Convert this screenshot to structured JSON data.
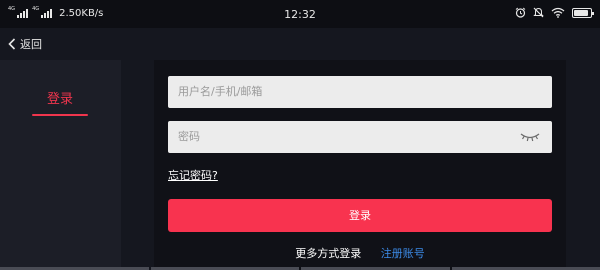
{
  "status_bar": {
    "signal1_label": "4G",
    "signal2_label": "4G",
    "net_speed": "2.50KB/s",
    "time": "12:32",
    "battery_level": 0.85
  },
  "title_bar": {
    "back_label": "返回"
  },
  "tabs": {
    "login_label": "登录"
  },
  "form": {
    "username_placeholder": "用户名/手机/邮箱",
    "password_placeholder": "密码",
    "forgot_password": "忘记密码?",
    "login_button": "登录",
    "more_login": "更多方式登录",
    "register": "注册账号"
  },
  "colors": {
    "accent": "#f8334f",
    "link": "#3c8be8",
    "background": "#15171f"
  }
}
